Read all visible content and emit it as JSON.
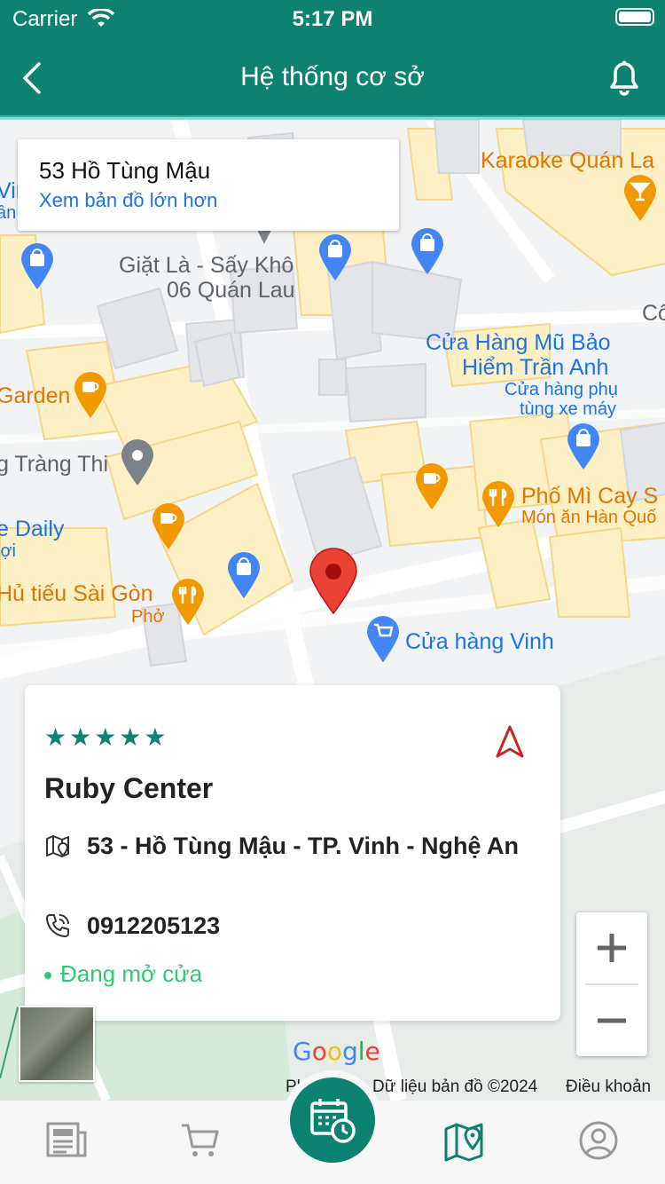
{
  "status_bar": {
    "carrier": "Carrier",
    "time": "5:17 PM"
  },
  "header": {
    "title": "Hệ thống cơ sở",
    "back_icon": "chevron-left-icon",
    "bell_icon": "bell-icon"
  },
  "map": {
    "info_card": {
      "address": "53 Hồ Tùng Mậu",
      "link": "Xem bản đồ lớn hơn"
    },
    "labels": {
      "karaoke": "Karaoke Quán La",
      "giat_la_1": "Giặt Là - Sấy Khô",
      "giat_la_2": "06 Quán Lau",
      "co": "Cô",
      "cua_hang_mu_1": "Cửa Hàng Mũ Bảo",
      "cua_hang_mu_2": "Hiểm Trần Anh",
      "cua_hang_mu_3": "Cửa hàng phụ",
      "cua_hang_mu_4": "tùng xe máy",
      "garden": "Garden",
      "trang_thi": "g Tràng Thi",
      "pho_mi": "Phố Mì Cay S",
      "mon_an": "Món ăn Hàn Quố",
      "daily": "e Daily",
      "loi": "lợi",
      "hu_tieu": "Hủ tiếu Sài Gòn",
      "pho": "Phở",
      "cua_hang_vinh": "Cửa hàng Vinh",
      "vin": "Vin",
      "an": "ần"
    },
    "zoom_in": "+",
    "zoom_out": "−",
    "google_logo": "Google",
    "attribution_left": "Phí",
    "attribution_data": "Dữ liệu bản đồ ©2024",
    "attribution_terms": "Điều khoản"
  },
  "center": {
    "rating": 5,
    "stars": "★★★★★",
    "name": "Ruby Center",
    "address": "53 - Hồ Tùng Mậu - TP. Vinh - Nghệ An",
    "phone": "0912205123",
    "status": "Đang mở cửa"
  },
  "colors": {
    "primary": "#0d8270",
    "open_green": "#2ecc71",
    "map_pin_red": "#ea4335"
  },
  "tabs": [
    {
      "name": "news",
      "icon": "newspaper-icon"
    },
    {
      "name": "cart",
      "icon": "cart-icon"
    },
    {
      "name": "booking",
      "icon": "calendar-clock-icon"
    },
    {
      "name": "map",
      "icon": "map-pin-icon",
      "active": true
    },
    {
      "name": "profile",
      "icon": "user-icon"
    }
  ]
}
